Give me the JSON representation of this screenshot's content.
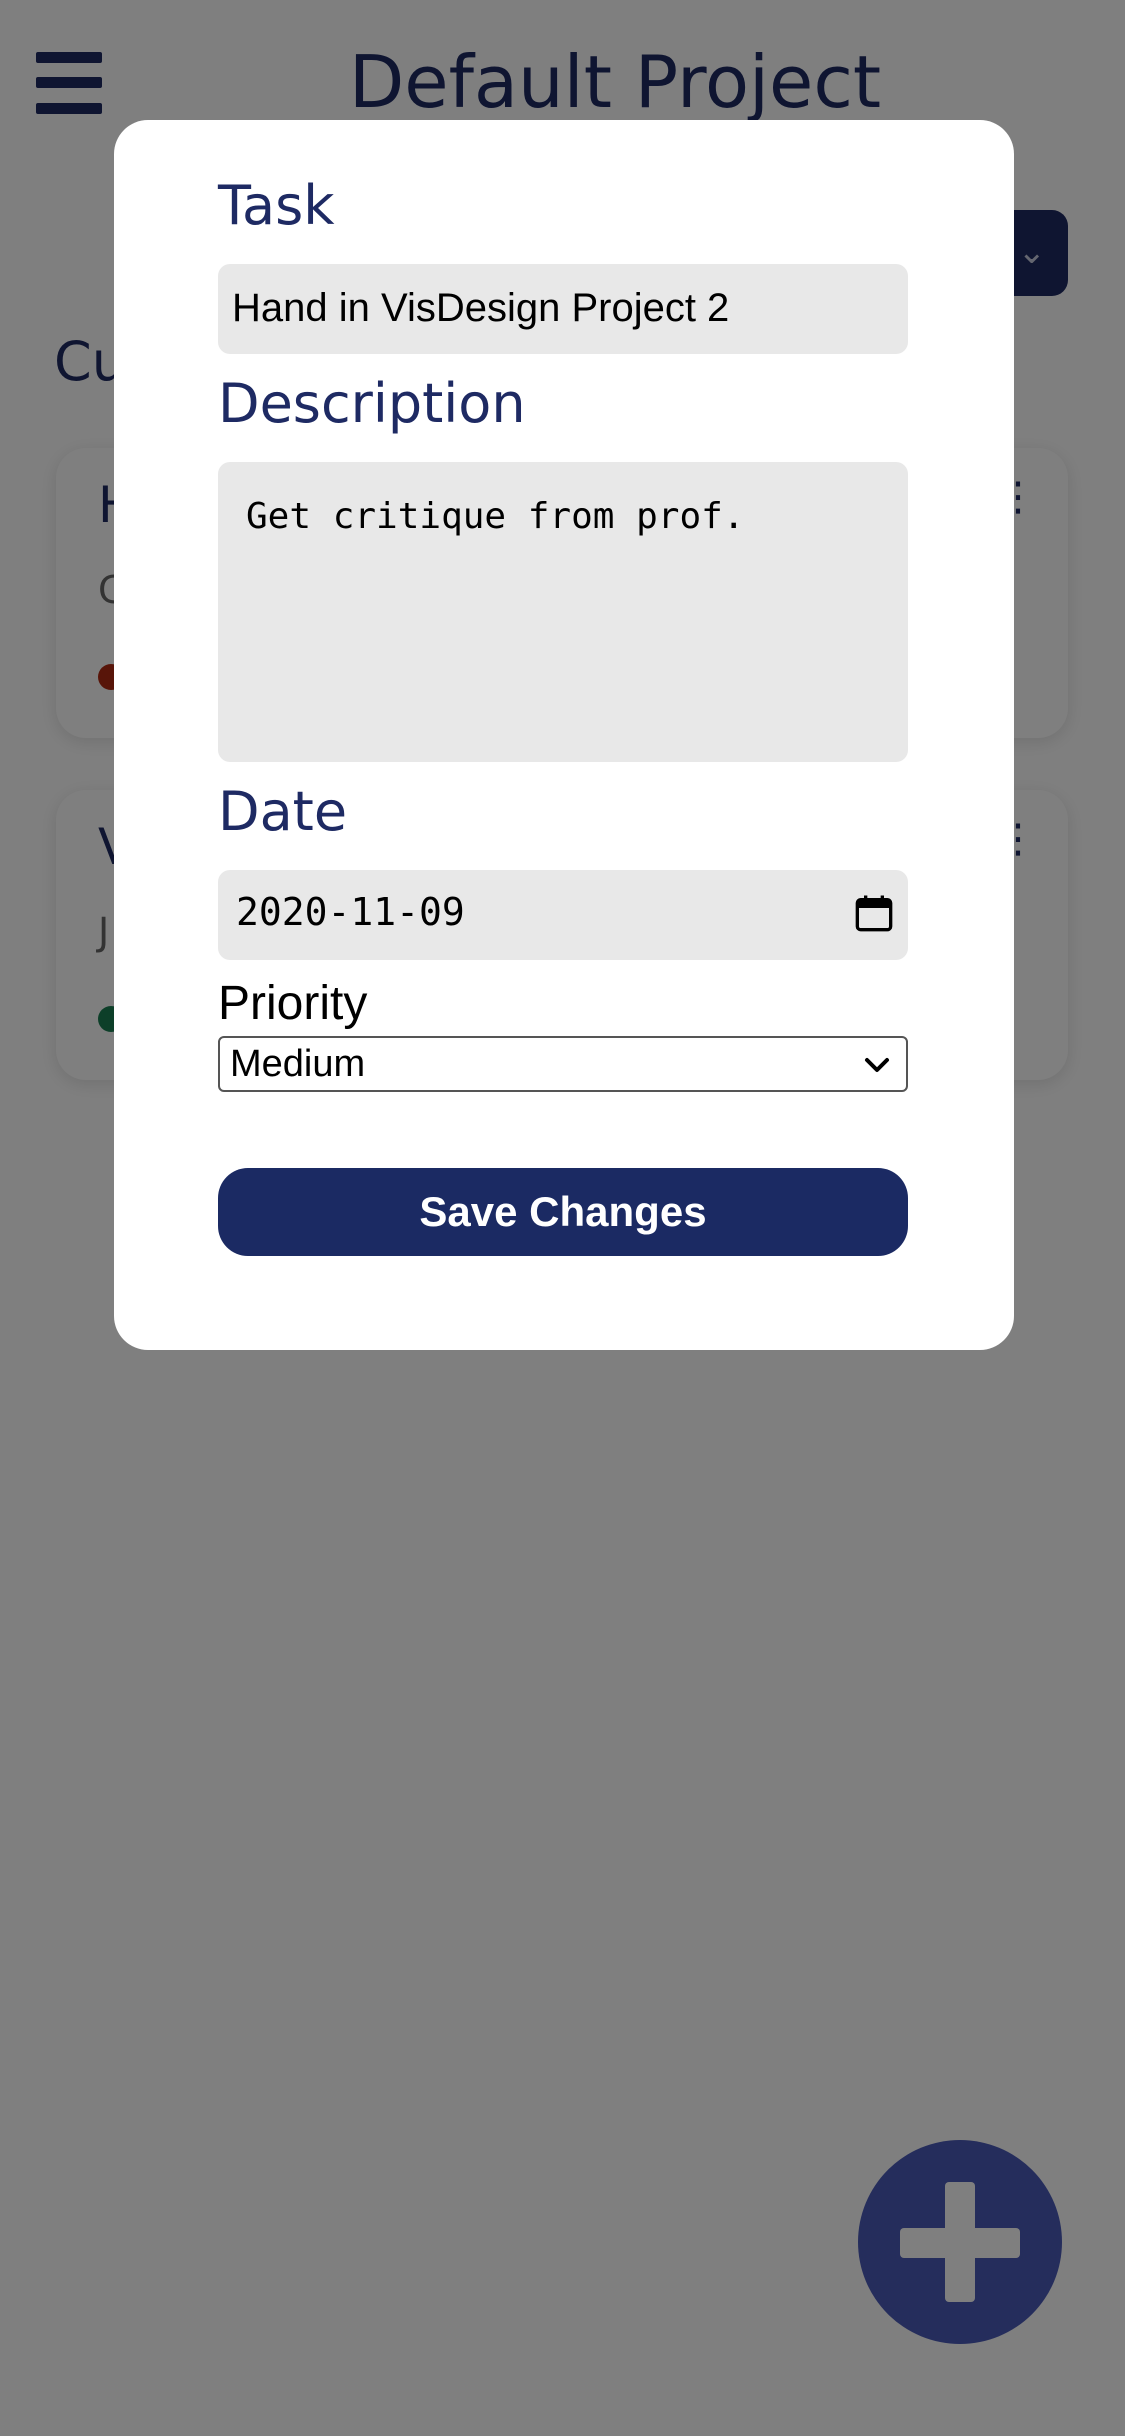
{
  "header": {
    "title": "Default Project",
    "menu_icon": "hamburger-menu-icon"
  },
  "project_dropdown": {
    "icon": "chevron-down-icon"
  },
  "section": {
    "heading_partial": "Cu"
  },
  "task_cards": [
    {
      "title_partial": "H",
      "desc_partial": "G",
      "priority_color": "#b12a13",
      "more_icon": "more-icon"
    },
    {
      "title_partial": "V",
      "desc_partial": "J",
      "priority_color": "#1a7f52",
      "more_icon": "more-icon"
    }
  ],
  "modal": {
    "task_label": "Task",
    "task_value": "Hand in VisDesign Project 2",
    "description_label": "Description",
    "description_value": "Get critique from prof.",
    "date_label": "Date",
    "date_value": "2020-11-09",
    "priority_label": "Priority",
    "priority_value": "Medium",
    "save_label": "Save Changes"
  },
  "fab": {
    "icon": "plus-icon"
  },
  "colors": {
    "primary": "#1e2a63",
    "overlay": "rgba(0,0,0,0.5)",
    "input_bg": "#e8e8e8",
    "fab": "#4b5bb8"
  }
}
